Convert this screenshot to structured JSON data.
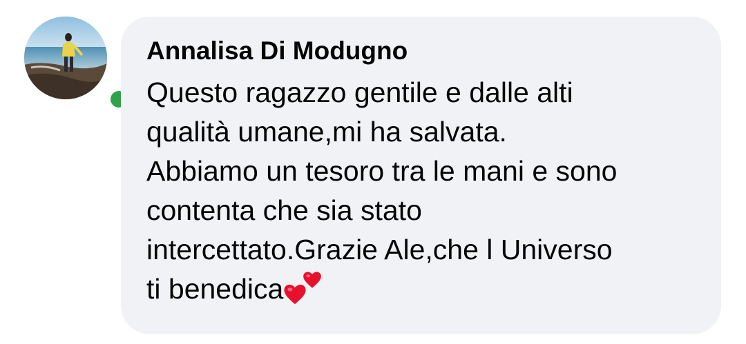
{
  "comment": {
    "author_name": "Annalisa Di Modugno",
    "message_lines": [
      "Questo ragazzo gentile e dalle alti",
      "qualità umane,mi ha salvata.",
      "Abbiamo un tesoro tra le mani e sono",
      "contenta che sia stato",
      "intercettato.Grazie Ale,che l Universo",
      "ti benedica"
    ],
    "emoji": "two-hearts-icon",
    "online": true
  },
  "colors": {
    "bubble_background": "#f0f2f5",
    "text": "#050505",
    "online_indicator": "#31a24c",
    "heart": "#e8112d"
  }
}
